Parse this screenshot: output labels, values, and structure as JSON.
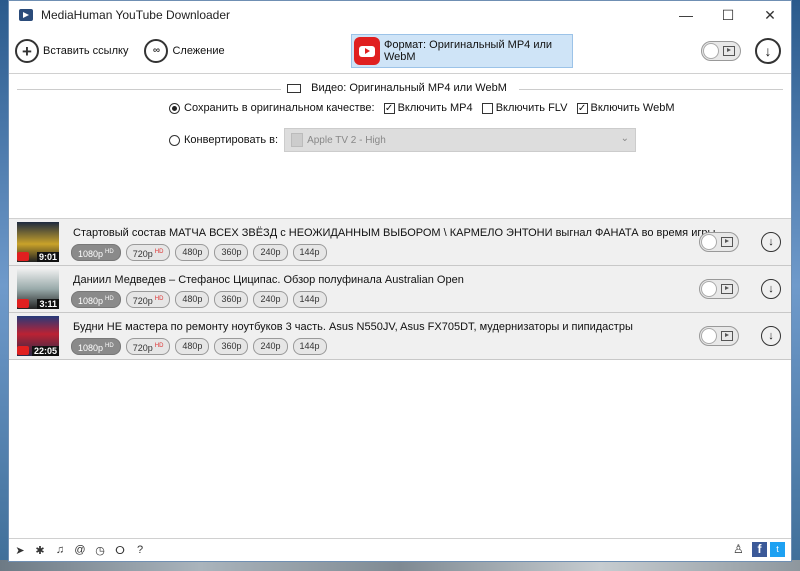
{
  "window": {
    "title": "MediaHuman YouTube Downloader",
    "controls": [
      "—",
      "☐",
      "✕"
    ]
  },
  "toolbar": {
    "paste_label": "Вставить ссылку",
    "tracking_label": "Слежение",
    "format_label": "Формат: Оригинальный MP4 или WebM"
  },
  "settings": {
    "section_title": "Видео: Оригинальный MP4 или WebM",
    "keep_original_label": "Сохранить в оригинальном качестве:",
    "include_mp4": "Включить MP4",
    "include_flv": "Включить FLV",
    "include_webm": "Включить WebM",
    "convert_label": "Конвертировать в:",
    "convert_value": "Apple TV 2 - High"
  },
  "items": [
    {
      "title": "Стартовый состав МАТЧА ВСЕХ ЗВЁЗД с НЕОЖИДАННЫМ ВЫБОРОМ \\ КАРМЕЛО ЭНТОНИ выгнал ФАНАТА во время игры",
      "duration": "9:01",
      "qualities": [
        {
          "label": "1080p",
          "hd": "HD",
          "selected": true
        },
        {
          "label": "720p",
          "hd": "HD",
          "selected": false
        },
        {
          "label": "480p",
          "hd": "",
          "selected": false
        },
        {
          "label": "360p",
          "hd": "",
          "selected": false
        },
        {
          "label": "240p",
          "hd": "",
          "selected": false
        },
        {
          "label": "144p",
          "hd": "",
          "selected": false
        }
      ]
    },
    {
      "title": "Даниил Медведев – Стефанос Циципас. Обзор полуфинала Australian Open",
      "duration": "3:11",
      "qualities": [
        {
          "label": "1080p",
          "hd": "HD",
          "selected": true
        },
        {
          "label": "720p",
          "hd": "HD",
          "selected": false
        },
        {
          "label": "480p",
          "hd": "",
          "selected": false
        },
        {
          "label": "360p",
          "hd": "",
          "selected": false
        },
        {
          "label": "240p",
          "hd": "",
          "selected": false
        },
        {
          "label": "144p",
          "hd": "",
          "selected": false
        }
      ]
    },
    {
      "title": "Будни НЕ мастера по ремонту ноутбуков 3 часть. Asus N550JV, Asus FX705DT, мудернизаторы и пипидастры",
      "duration": "22:05",
      "qualities": [
        {
          "label": "1080p",
          "hd": "HD",
          "selected": true
        },
        {
          "label": "720p",
          "hd": "HD",
          "selected": false
        },
        {
          "label": "480p",
          "hd": "",
          "selected": false
        },
        {
          "label": "360p",
          "hd": "",
          "selected": false
        },
        {
          "label": "240p",
          "hd": "",
          "selected": false
        },
        {
          "label": "144p",
          "hd": "",
          "selected": false
        }
      ]
    }
  ],
  "bottom_icons": [
    "send-icon",
    "gear-icon",
    "music-icon",
    "snail-icon",
    "clock-icon",
    "binoculars-icon",
    "help-icon"
  ],
  "colors": {
    "format_bg": "#cfe4f7",
    "youtube_red": "#e02020",
    "selected_quality": "#8a8a8a"
  }
}
